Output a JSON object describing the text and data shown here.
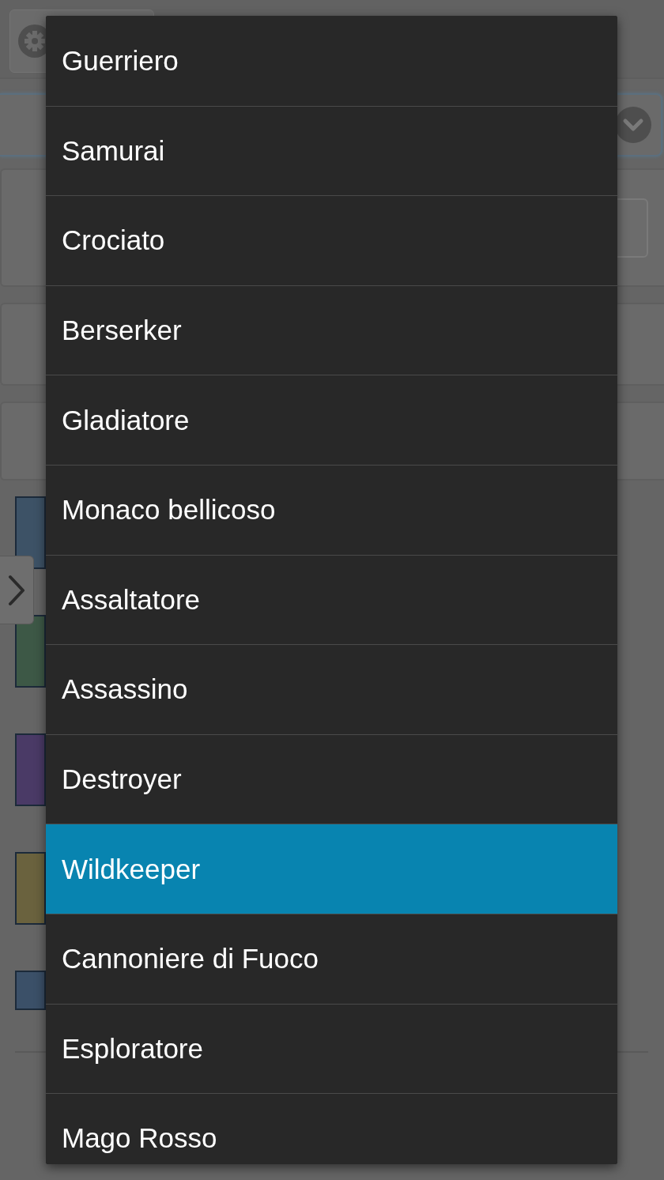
{
  "dropdown_menu": {
    "options": [
      {
        "label": "Guerriero",
        "selected": false
      },
      {
        "label": "Samurai",
        "selected": false
      },
      {
        "label": "Crociato",
        "selected": false
      },
      {
        "label": "Berserker",
        "selected": false
      },
      {
        "label": "Gladiatore",
        "selected": false
      },
      {
        "label": "Monaco bellicoso",
        "selected": false
      },
      {
        "label": "Assaltatore",
        "selected": false
      },
      {
        "label": "Assassino",
        "selected": false
      },
      {
        "label": "Destroyer",
        "selected": false
      },
      {
        "label": "Wildkeeper",
        "selected": true
      },
      {
        "label": "Cannoniere di Fuoco",
        "selected": false
      },
      {
        "label": "Esploratore",
        "selected": false
      },
      {
        "label": "Mago Rosso",
        "selected": false
      }
    ]
  }
}
